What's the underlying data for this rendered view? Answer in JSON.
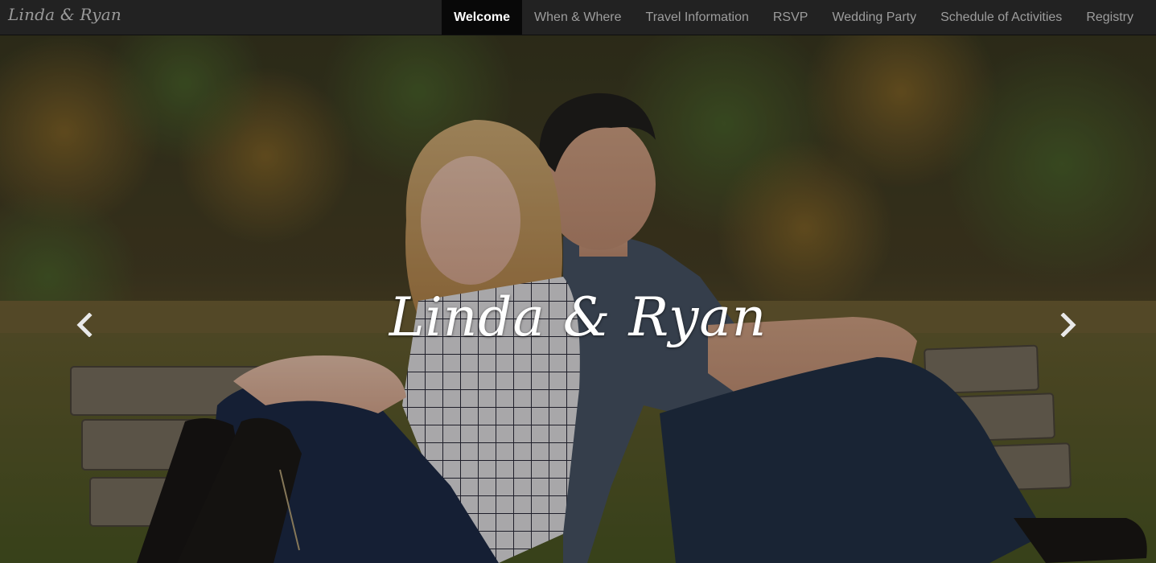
{
  "brand": "Linda & Ryan",
  "nav": {
    "items": [
      {
        "label": "Welcome",
        "active": true
      },
      {
        "label": "When & Where",
        "active": false
      },
      {
        "label": "Travel Information",
        "active": false
      },
      {
        "label": "RSVP",
        "active": false
      },
      {
        "label": "Wedding Party",
        "active": false
      },
      {
        "label": "Schedule of Activities",
        "active": false
      },
      {
        "label": "Registry",
        "active": false
      }
    ]
  },
  "carousel": {
    "caption": "Linda & Ryan",
    "prev_icon": "chevron-left-icon",
    "next_icon": "chevron-right-icon"
  },
  "colors": {
    "navbar_bg": "#222222",
    "nav_active_bg": "#080808",
    "nav_text": "#9d9d9d",
    "nav_active_text": "#ffffff"
  }
}
